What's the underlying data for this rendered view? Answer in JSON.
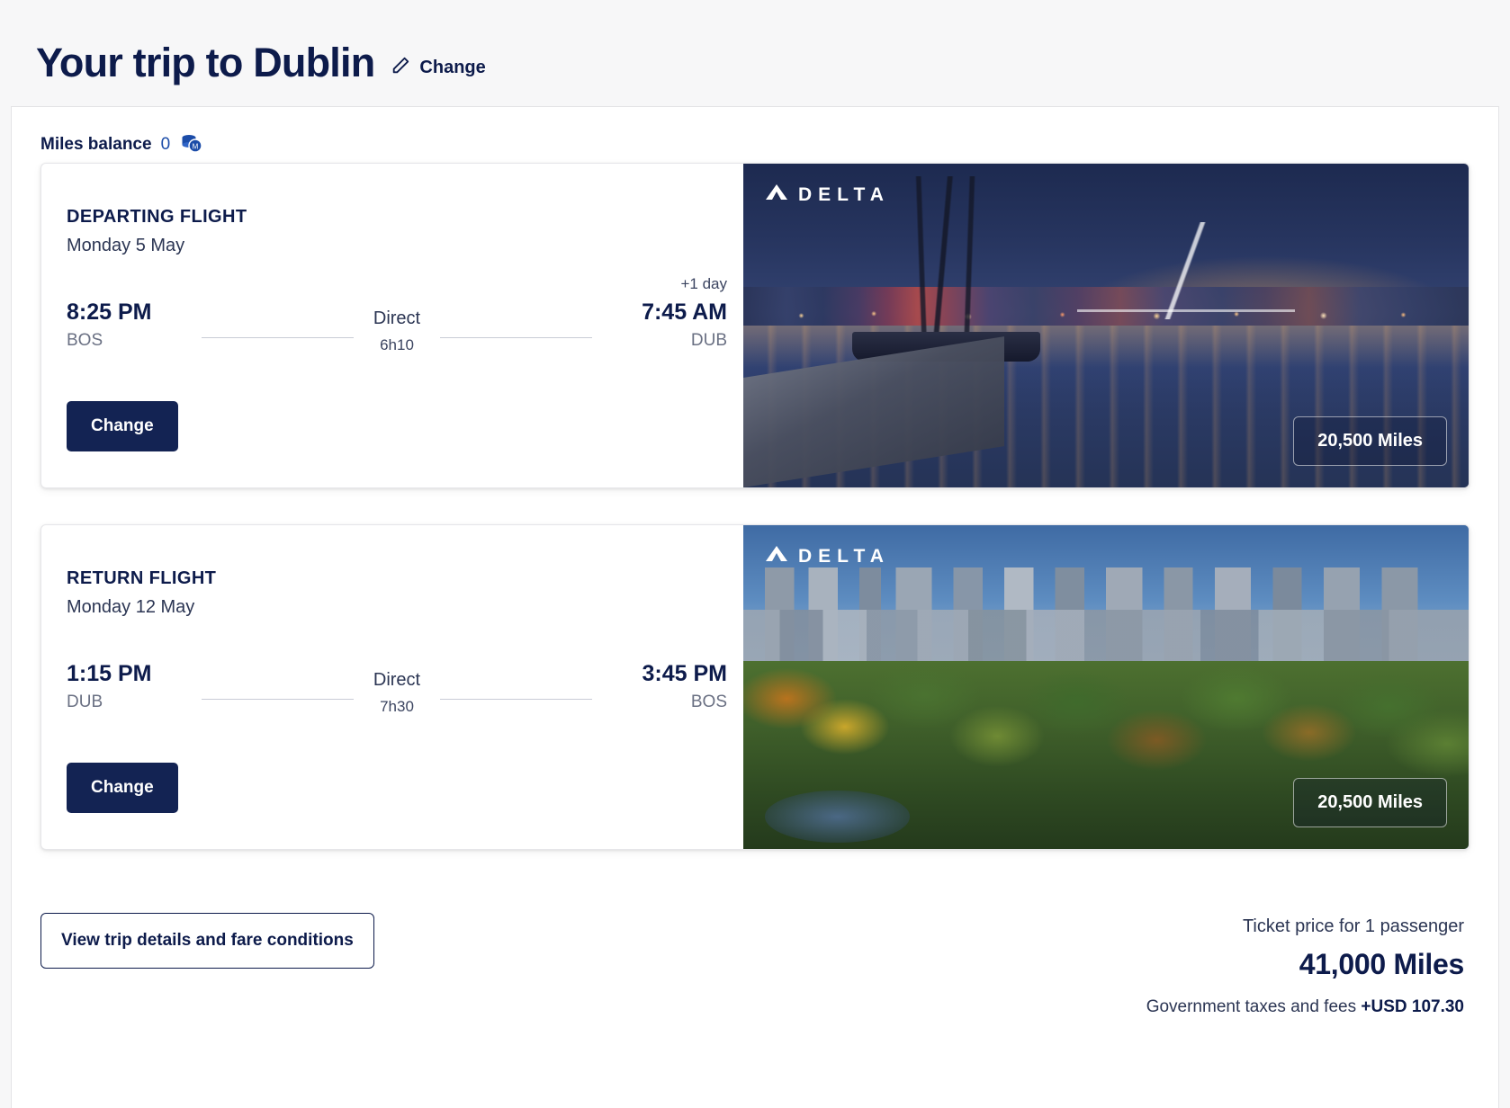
{
  "header": {
    "title": "Your trip to Dublin",
    "change_label": "Change",
    "pencil_icon": "pencil-icon"
  },
  "miles_balance": {
    "label": "Miles balance",
    "value": "0",
    "icon": "miles-coin-icon"
  },
  "flights": [
    {
      "segment_label": "DEPARTING FLIGHT",
      "date": "Monday 5 May",
      "depart_time": "8:25 PM",
      "depart_code": "BOS",
      "arrive_time": "7:45 AM",
      "arrive_code": "DUB",
      "arrive_day_offset": "+1 day",
      "stops": "Direct",
      "duration": "6h10",
      "change_label": "Change",
      "airline": "DELTA",
      "miles_badge": "20,500 Miles",
      "image_alt": "dublin-night-scene"
    },
    {
      "segment_label": "RETURN FLIGHT",
      "date": "Monday 12 May",
      "depart_time": "1:15 PM",
      "depart_code": "DUB",
      "arrive_time": "3:45 PM",
      "arrive_code": "BOS",
      "arrive_day_offset": "",
      "stops": "Direct",
      "duration": "7h30",
      "change_label": "Change",
      "airline": "DELTA",
      "miles_badge": "20,500 Miles",
      "image_alt": "boston-skyline-scene"
    }
  ],
  "footer": {
    "details_button": "View trip details and fare conditions",
    "price_caption": "Ticket price for 1 passenger",
    "price_total": "41,000 Miles",
    "taxes_label": "Government taxes and fees",
    "taxes_value": "+USD 107.30"
  },
  "colors": {
    "brand_navy": "#0d1b4b",
    "button_navy": "#132353",
    "page_bg": "#f7f7f8",
    "miles_blue": "#1b4ca8"
  }
}
